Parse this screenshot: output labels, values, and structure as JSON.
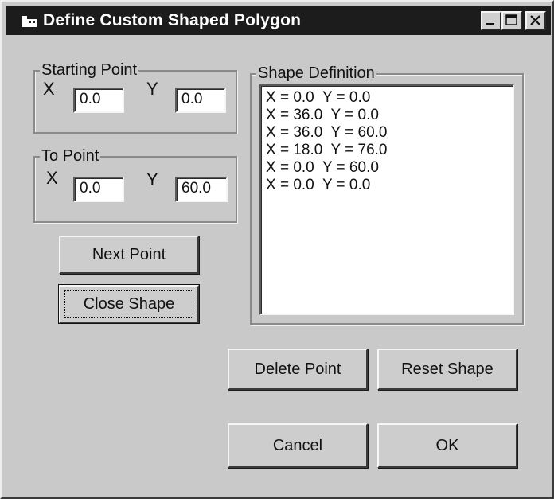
{
  "window": {
    "title": "Define Custom Shaped Polygon"
  },
  "starting_point": {
    "label": "Starting Point",
    "x_label": "X",
    "y_label": "Y",
    "x_value": "0.0",
    "y_value": "0.0"
  },
  "to_point": {
    "label": "To Point",
    "x_label": "X",
    "y_label": "Y",
    "x_value": "0.0",
    "y_value": "60.0"
  },
  "shape_definition": {
    "label": "Shape Definition",
    "items": [
      "X = 0.0  Y = 0.0",
      "X = 36.0  Y = 0.0",
      "X = 36.0  Y = 60.0",
      "X = 18.0  Y = 76.0",
      "X = 0.0  Y = 60.0",
      "X = 0.0  Y = 0.0"
    ]
  },
  "buttons": {
    "next_point": "Next Point",
    "close_shape": "Close Shape",
    "delete_point": "Delete Point",
    "reset_shape": "Reset Shape",
    "cancel": "Cancel",
    "ok": "OK"
  },
  "icons": {
    "app": "app-icon",
    "minimize": "minimize-icon",
    "maximize": "maximize-icon",
    "close": "close-icon"
  }
}
